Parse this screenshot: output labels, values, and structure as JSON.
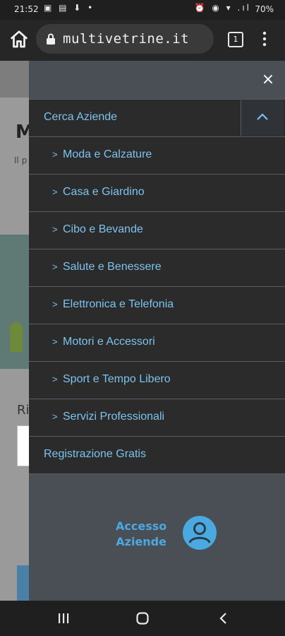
{
  "status_bar": {
    "time": "21:52",
    "battery": "70%",
    "left_icons": "▣ ▤ ⬇ •",
    "right_icons": "⏰ ◉ ▾ .ıl"
  },
  "browser": {
    "url": "multivetrine.it",
    "tab_count": "1"
  },
  "background_page": {
    "logo_fragment": "M",
    "tagline_fragment": "Il p",
    "heading_fragment": "Ri"
  },
  "menu": {
    "close_label": "×",
    "section_title": "Cerca Aziende",
    "categories": [
      {
        "label": "Moda e Calzature"
      },
      {
        "label": "Casa e Giardino"
      },
      {
        "label": "Cibo e Bevande"
      },
      {
        "label": "Salute e Benessere"
      },
      {
        "label": "Elettronica e Telefonia"
      },
      {
        "label": "Motori e Accessori"
      },
      {
        "label": "Sport e Tempo Libero"
      },
      {
        "label": "Servizi Professionali"
      }
    ],
    "registration": "Registrazione Gratis",
    "access": {
      "line1": "Accesso",
      "line2": "Aziende"
    }
  },
  "colors": {
    "menu_text": "#7cc3ee",
    "access_blue": "#4aa9e0",
    "row_bg": "#2b2b2b",
    "panel_bg": "#4a4e55"
  }
}
